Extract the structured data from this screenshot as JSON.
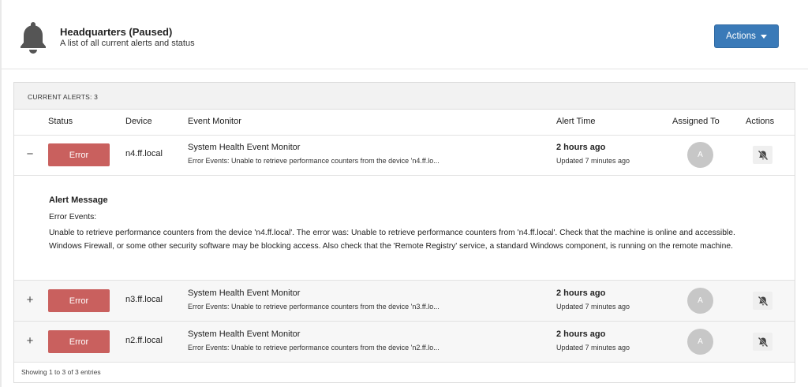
{
  "header": {
    "title": "Headquarters (Paused)",
    "subtitle": "A list of all current alerts and status",
    "icon": "bell-icon",
    "actions_label": "Actions"
  },
  "panel": {
    "heading": "CURRENT ALERTS: 3",
    "columns": [
      "Status",
      "Device",
      "Event Monitor",
      "Alert Time",
      "Assigned To",
      "Actions"
    ],
    "rows": [
      {
        "toggle": "−",
        "status": "Error",
        "device": "n4.ff.local",
        "monitor": "System Health Event Monitor",
        "monitor_desc": "Error Events: Unable to retrieve performance counters from the device 'n4.ff.lo...",
        "time": "2 hours ago",
        "updated": "Updated 7 minutes ago",
        "assignee": "A"
      },
      {
        "toggle": "+",
        "status": "Error",
        "device": "n3.ff.local",
        "monitor": "System Health Event Monitor",
        "monitor_desc": "Error Events: Unable to retrieve performance counters from the device 'n3.ff.lo...",
        "time": "2 hours ago",
        "updated": "Updated 7 minutes ago",
        "assignee": "A"
      },
      {
        "toggle": "+",
        "status": "Error",
        "device": "n2.ff.local",
        "monitor": "System Health Event Monitor",
        "monitor_desc": "Error Events: Unable to retrieve performance counters from the device 'n2.ff.lo...",
        "time": "2 hours ago",
        "updated": "Updated 7 minutes ago",
        "assignee": "A"
      }
    ],
    "message": {
      "title": "Alert Message",
      "line1": "Error Events:",
      "body": "Unable to retrieve performance counters from the device 'n4.ff.local'. The error was: Unable to retrieve performance counters from 'n4.ff.local'. Check that the machine is online and accessible. Windows Firewall, or some other security software may be blocking access. Also check that the 'Remote Registry' service, a standard Windows component, is running on the remote machine."
    },
    "footer": "Showing 1 to 3 of 3 entries"
  },
  "colors": {
    "accent": "#3a7ab8",
    "error": "#c9605e",
    "avatar": "#c7c7c7"
  }
}
